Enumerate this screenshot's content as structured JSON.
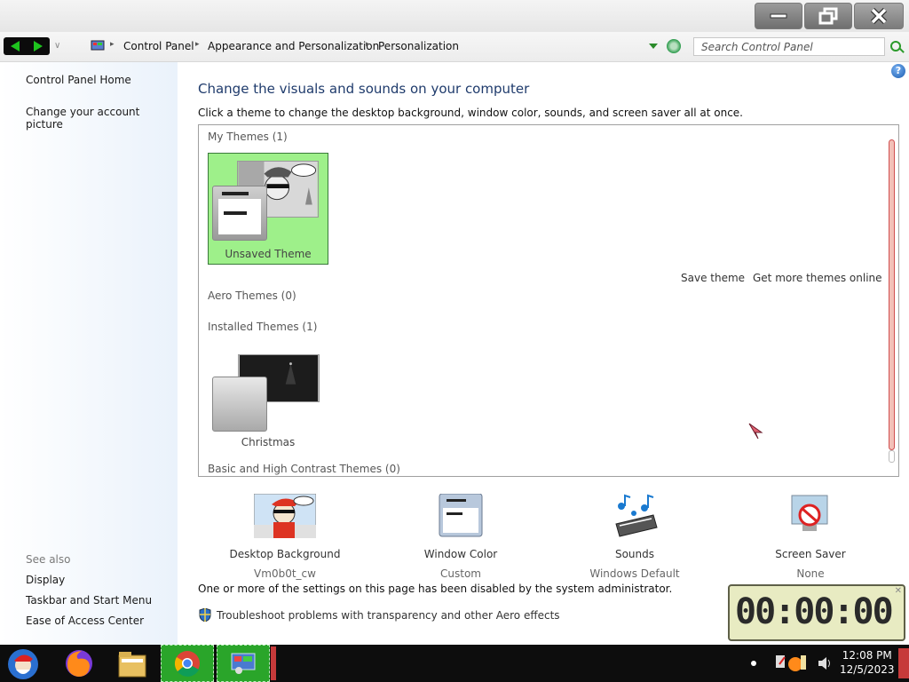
{
  "window": {
    "minimize_icon": "minimize-icon",
    "restore_icon": "restore-icon",
    "close_icon": "close-icon"
  },
  "address": {
    "breadcrumbs": [
      "Control Panel",
      "Appearance and Personalization",
      "Personalization"
    ],
    "search_placeholder": "Search Control Panel"
  },
  "sidebar": {
    "links": [
      "Control Panel Home",
      "Change your account picture"
    ],
    "see_also_title": "See also",
    "see_also": [
      "Display",
      "Taskbar and Start Menu",
      "Ease of Access Center"
    ]
  },
  "main": {
    "help_label": "?",
    "heading": "Change the visuals and sounds on your computer",
    "subheading": "Click a theme to change the desktop background, window color, sounds, and screen saver all at once.",
    "groups": {
      "my_themes": "My Themes (1)",
      "aero_themes": "Aero Themes (0)",
      "installed_themes": "Installed Themes (1)",
      "basic_themes": "Basic and High Contrast Themes (0)"
    },
    "themes": {
      "unsaved": "Unsaved Theme",
      "christmas": "Christmas"
    },
    "save_theme": "Save theme",
    "get_more": "Get more themes online",
    "settings": [
      {
        "label": "Desktop Background",
        "value": "Vm0b0t_cw"
      },
      {
        "label": "Window Color",
        "value": "Custom"
      },
      {
        "label": "Sounds",
        "value": "Windows Default"
      },
      {
        "label": "Screen Saver",
        "value": "None"
      }
    ],
    "admin_note": "One or more of the settings on this page has been disabled by the system administrator.",
    "troubleshoot": "Troubleshoot problems with transparency and other Aero effects"
  },
  "timer": {
    "digits": "00:00:00"
  },
  "taskbar": {
    "time": "12:08 PM",
    "date": "12/5/2023"
  },
  "colors": {
    "selected_theme_bg": "#9ef08a",
    "heading": "#1f3b6c",
    "nav_arrows": "#1ec31e",
    "taskbar_active": "#2aa52a"
  }
}
